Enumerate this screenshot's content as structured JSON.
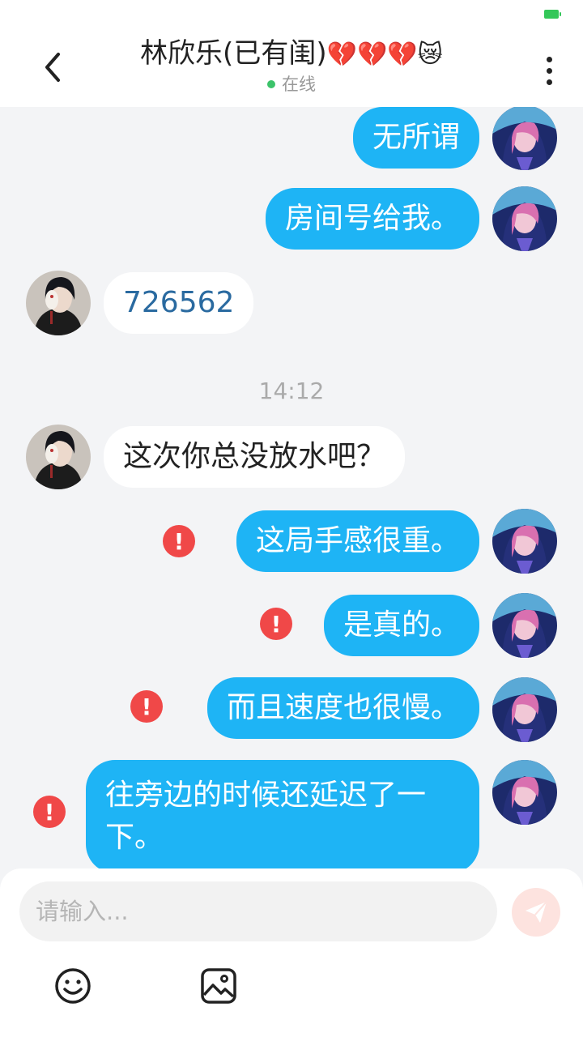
{
  "header": {
    "title": "林欣乐(已有闺)",
    "title_emojis": "💔💔💔😿",
    "status": "在线"
  },
  "messages": [
    {
      "side": "me",
      "text": "无所谓",
      "error": false
    },
    {
      "side": "me",
      "text": "房间号给我。",
      "error": false
    },
    {
      "side": "other",
      "text": "726562",
      "error": false
    },
    {
      "side": "other",
      "text": "这次你总没放水吧？",
      "error": false
    },
    {
      "side": "me",
      "text": "这局手感很重。",
      "error": true
    },
    {
      "side": "me",
      "text": "是真的。",
      "error": true
    },
    {
      "side": "me",
      "text": "而且速度也很慢。",
      "error": true
    },
    {
      "side": "me",
      "text": "往旁边的时候还延迟了一下。",
      "error": true
    }
  ],
  "timestamp": "14:12",
  "error_mark": "!",
  "composer": {
    "placeholder": "请输入...",
    "value": ""
  },
  "icons": {
    "back": "chevron-left-icon",
    "more": "more-vertical-icon",
    "send": "send-icon",
    "emoji": "smiley-icon",
    "image": "image-icon",
    "error": "alert-icon"
  },
  "colors": {
    "my_bubble": "#1eb4f5",
    "other_bubble": "#ffffff",
    "background": "#f3f4f6",
    "online": "#3cc36a",
    "error": "#f04848",
    "send_disabled": "#fde3df"
  }
}
